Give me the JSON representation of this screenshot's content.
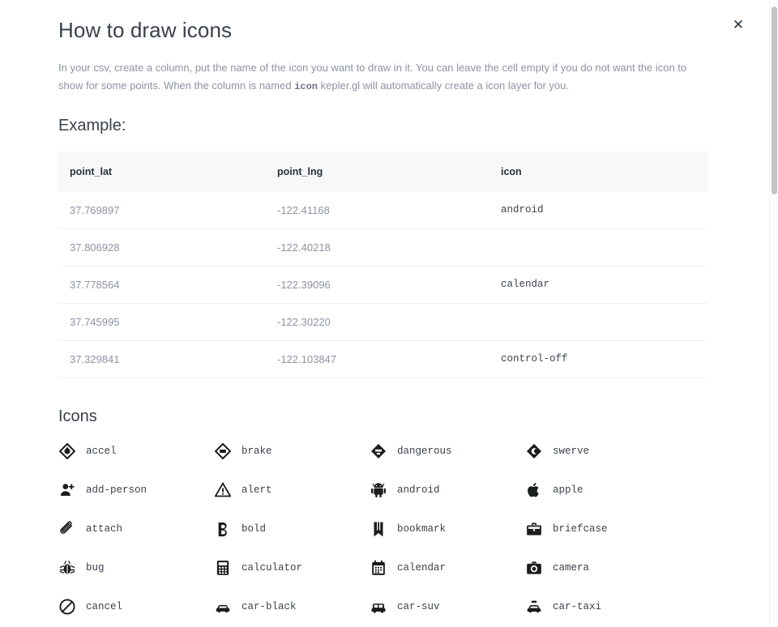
{
  "modal": {
    "title": "How to draw icons",
    "close_label": "✕",
    "close_icon": "close-icon"
  },
  "description": {
    "part1": "In your csv, create a column, put the name of the icon you want to draw in it. You can leave the cell empty if you do not want the icon to show for some points. When the column is named ",
    "code": "icon",
    "part2": " kepler.gl will automatically create a icon layer for you."
  },
  "example": {
    "heading": "Example:",
    "columns": [
      "point_lat",
      "point_lng",
      "icon"
    ],
    "rows": [
      {
        "point_lat": "37.769897",
        "point_lng": "-122.41168",
        "icon": "android"
      },
      {
        "point_lat": "37.806928",
        "point_lng": "-122.40218",
        "icon": ""
      },
      {
        "point_lat": "37.778564",
        "point_lng": "-122.39096",
        "icon": "calendar"
      },
      {
        "point_lat": "37.745995",
        "point_lng": "-122.30220",
        "icon": ""
      },
      {
        "point_lat": "37.329841",
        "point_lng": "-122.103847",
        "icon": "control-off"
      }
    ]
  },
  "icons_section": {
    "heading": "Icons",
    "items": [
      {
        "name": "accel",
        "glyph": "accel-icon"
      },
      {
        "name": "brake",
        "glyph": "brake-icon"
      },
      {
        "name": "dangerous",
        "glyph": "dangerous-icon"
      },
      {
        "name": "swerve",
        "glyph": "swerve-icon"
      },
      {
        "name": "add-person",
        "glyph": "add-person-icon"
      },
      {
        "name": "alert",
        "glyph": "alert-icon"
      },
      {
        "name": "android",
        "glyph": "android-icon"
      },
      {
        "name": "apple",
        "glyph": "apple-icon"
      },
      {
        "name": "attach",
        "glyph": "attach-icon"
      },
      {
        "name": "bold",
        "glyph": "bold-icon"
      },
      {
        "name": "bookmark",
        "glyph": "bookmark-icon"
      },
      {
        "name": "briefcase",
        "glyph": "briefcase-icon"
      },
      {
        "name": "bug",
        "glyph": "bug-icon"
      },
      {
        "name": "calculator",
        "glyph": "calculator-icon"
      },
      {
        "name": "calendar",
        "glyph": "calendar-icon"
      },
      {
        "name": "camera",
        "glyph": "camera-icon"
      },
      {
        "name": "cancel",
        "glyph": "cancel-icon"
      },
      {
        "name": "car-black",
        "glyph": "car-black-icon"
      },
      {
        "name": "car-suv",
        "glyph": "car-suv-icon"
      },
      {
        "name": "car-taxi",
        "glyph": "car-taxi-icon"
      }
    ]
  },
  "colors": {
    "title_text": "#3a414c",
    "body_text": "#8e93a3",
    "table_header_bg": "#f8f8f9",
    "table_header_text": "#29323c",
    "row_border": "#f1f1f3",
    "scroll_thumb": "#c4c4c4",
    "background": "#ffffff"
  }
}
